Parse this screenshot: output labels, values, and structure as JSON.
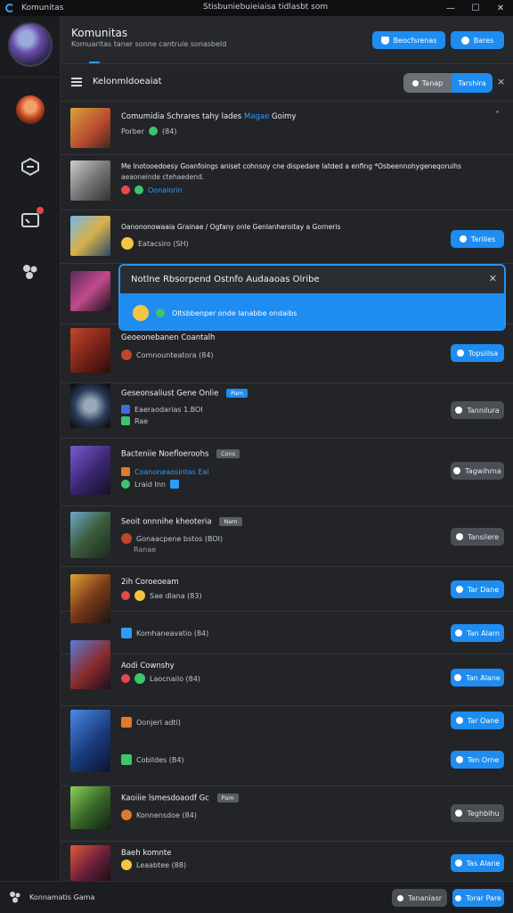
{
  "window": {
    "app_name": "Komunitas",
    "title": "Stisbuniebuieiaisa tidlasbt som",
    "controls": [
      "—",
      "☐",
      "✕"
    ]
  },
  "header": {
    "title": "Komunitas",
    "subtitle": "Komuaritas taner sonne cantruie sonasbeld",
    "btn_primary": "Beocfsrenas",
    "btn_secondary": "Bares"
  },
  "toolbar": {
    "label": "Kelonmldoeaiat",
    "seg_left": "Tanap",
    "seg_right": "Tarshira",
    "close": "×"
  },
  "rows": [
    {
      "title": "Comumidia Schrares tahy lades",
      "title_hl": "Magae",
      "title_end": "Goimy",
      "meta": "Porber",
      "meta2": "(84)",
      "action": null
    },
    {
      "title": "Me lnotooedoesy Goanfoings aniset cohnsoy cne dispedare latded a enfing  *Osbeennohygeneqoruihs",
      "title2": "aeaoneinde ctehaedend.",
      "meta": "Oonalorin",
      "action": null
    },
    {
      "title": "Oanononowaaia Grainae / Ogfany onle Genlanheroitay a Gorneris",
      "meta": "Eatacsiro (SH)",
      "action": "Tarilies"
    },
    {
      "title": "Notlne Rbsorpend Ostnfo Audaaoas Olribe",
      "meta": "Oltsbbenper onde lanabbe ondaibs",
      "popup": true
    },
    {
      "title": "Geoeonebanen Coantalh",
      "meta": "Comnounteatora (84)",
      "action": "Topsiilsa"
    },
    {
      "title": "Geseonsaliust Gene Onlie",
      "badge": "Pam",
      "meta": "Eaeraodarias 1.BOI",
      "meta2": "Rae",
      "action": "Tannilura"
    },
    {
      "title": "Bacteniie Noefloeroohs",
      "badge": "Cons",
      "meta": "Coanoneaosintas Eal",
      "meta2": "Lraid Inn",
      "action": "Tagwihrna"
    },
    {
      "title": "Seoit onnnihe kheoteria",
      "badge": "Nam",
      "meta": "Gonaacpene bstos (BOI)",
      "meta2": "Ranae",
      "action": "Tansilere"
    },
    {
      "title": "2ih Coroeoeam",
      "meta": "Sae dlana (83)",
      "action": "Tar Dane"
    },
    {
      "title": "Komhaneavatio (84)",
      "action": "Tan Alarn"
    },
    {
      "title": "Aodi Cownshy",
      "meta": "Laocnailo (84)",
      "action": "Tan Alane"
    },
    {
      "title": "Oonjerl adti)",
      "action": "Tar Oane"
    },
    {
      "title": "Cobildes (B4)",
      "action": "Ten Orne"
    },
    {
      "title": "Kaoiiie lsmesdoaodf Gc",
      "badge": "Pam",
      "meta": "Konnensdoe (84)",
      "action": "Teghblhu"
    },
    {
      "title": "Baeh komnte",
      "meta": "Leaabtee (88)",
      "action": "Tas Alane"
    }
  ],
  "bottom": {
    "label": "Konnamatis Gama",
    "btn1": "Tananiasr",
    "btn2": "Torar Pare"
  }
}
